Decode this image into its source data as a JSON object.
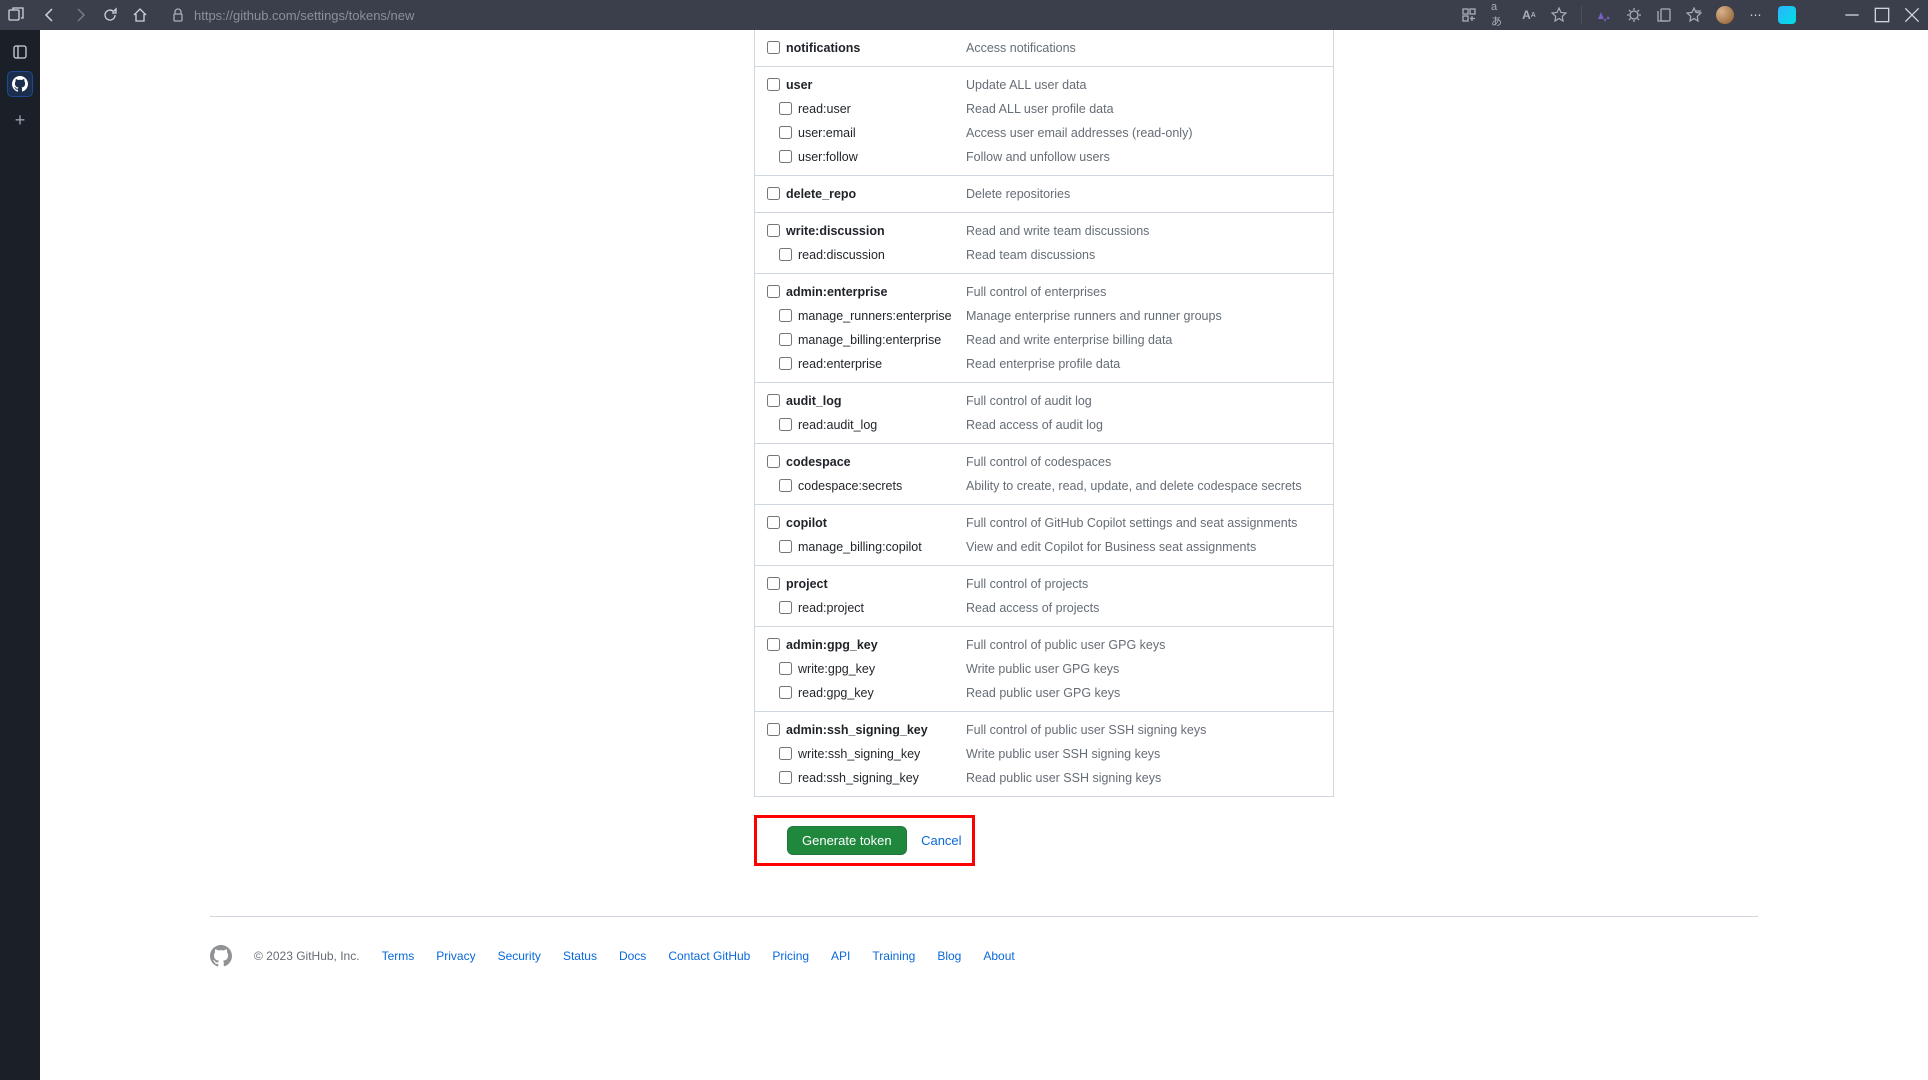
{
  "browser": {
    "url": "https://github.com/settings/tokens/new"
  },
  "scopes": [
    {
      "items": [
        {
          "name": "notifications",
          "desc": "Access notifications",
          "level": 0
        }
      ]
    },
    {
      "items": [
        {
          "name": "user",
          "desc": "Update ALL user data",
          "level": 0
        },
        {
          "name": "read:user",
          "desc": "Read ALL user profile data",
          "level": 1
        },
        {
          "name": "user:email",
          "desc": "Access user email addresses (read-only)",
          "level": 1
        },
        {
          "name": "user:follow",
          "desc": "Follow and unfollow users",
          "level": 1
        }
      ]
    },
    {
      "items": [
        {
          "name": "delete_repo",
          "desc": "Delete repositories",
          "level": 0
        }
      ]
    },
    {
      "items": [
        {
          "name": "write:discussion",
          "desc": "Read and write team discussions",
          "level": 0
        },
        {
          "name": "read:discussion",
          "desc": "Read team discussions",
          "level": 1
        }
      ]
    },
    {
      "items": [
        {
          "name": "admin:enterprise",
          "desc": "Full control of enterprises",
          "level": 0
        },
        {
          "name": "manage_runners:enterprise",
          "desc": "Manage enterprise runners and runner groups",
          "level": 1
        },
        {
          "name": "manage_billing:enterprise",
          "desc": "Read and write enterprise billing data",
          "level": 1
        },
        {
          "name": "read:enterprise",
          "desc": "Read enterprise profile data",
          "level": 1
        }
      ]
    },
    {
      "items": [
        {
          "name": "audit_log",
          "desc": "Full control of audit log",
          "level": 0
        },
        {
          "name": "read:audit_log",
          "desc": "Read access of audit log",
          "level": 1
        }
      ]
    },
    {
      "items": [
        {
          "name": "codespace",
          "desc": "Full control of codespaces",
          "level": 0
        },
        {
          "name": "codespace:secrets",
          "desc": "Ability to create, read, update, and delete codespace secrets",
          "level": 1
        }
      ]
    },
    {
      "items": [
        {
          "name": "copilot",
          "desc": "Full control of GitHub Copilot settings and seat assignments",
          "level": 0
        },
        {
          "name": "manage_billing:copilot",
          "desc": "View and edit Copilot for Business seat assignments",
          "level": 1
        }
      ]
    },
    {
      "items": [
        {
          "name": "project",
          "desc": "Full control of projects",
          "level": 0
        },
        {
          "name": "read:project",
          "desc": "Read access of projects",
          "level": 1
        }
      ]
    },
    {
      "items": [
        {
          "name": "admin:gpg_key",
          "desc": "Full control of public user GPG keys",
          "level": 0
        },
        {
          "name": "write:gpg_key",
          "desc": "Write public user GPG keys",
          "level": 1
        },
        {
          "name": "read:gpg_key",
          "desc": "Read public user GPG keys",
          "level": 1
        }
      ]
    },
    {
      "items": [
        {
          "name": "admin:ssh_signing_key",
          "desc": "Full control of public user SSH signing keys",
          "level": 0
        },
        {
          "name": "write:ssh_signing_key",
          "desc": "Write public user SSH signing keys",
          "level": 1
        },
        {
          "name": "read:ssh_signing_key",
          "desc": "Read public user SSH signing keys",
          "level": 1
        }
      ]
    }
  ],
  "buttons": {
    "generate": "Generate token",
    "cancel": "Cancel"
  },
  "footer": {
    "copyright": "© 2023 GitHub, Inc.",
    "links": [
      "Terms",
      "Privacy",
      "Security",
      "Status",
      "Docs",
      "Contact GitHub",
      "Pricing",
      "API",
      "Training",
      "Blog",
      "About"
    ]
  }
}
